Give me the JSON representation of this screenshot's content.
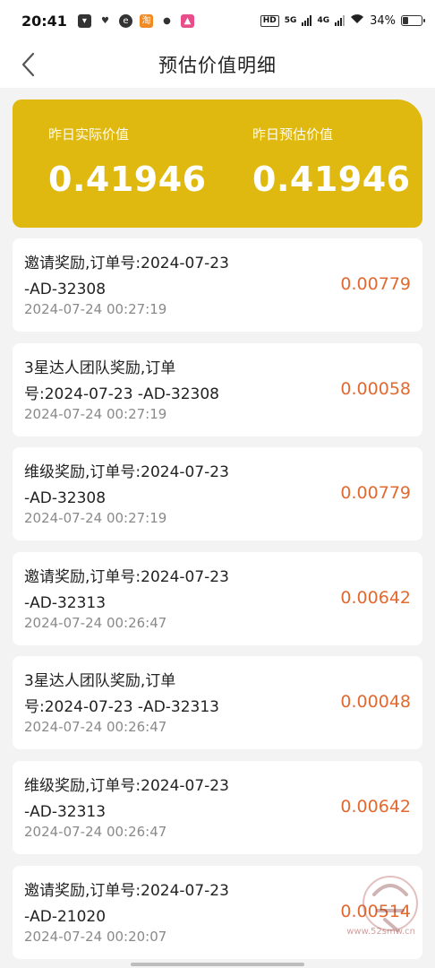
{
  "status_bar": {
    "time": "20:41",
    "network_5g": "5G",
    "network_4g": "4G",
    "hd_label": "HD",
    "battery_text": "34%",
    "battery_level": 0.34
  },
  "header": {
    "title": "预估价值明细"
  },
  "summary": {
    "actual_label": "昨日实际价值",
    "actual_value": "0.41946",
    "estimated_label": "昨日预估价值",
    "estimated_value": "0.41946",
    "accent_color": "#e0b910"
  },
  "records": [
    {
      "desc": "邀请奖励,订单号:2024-07-23 -AD-32308",
      "time": "2024-07-24 00:27:19",
      "amount": "0.00779"
    },
    {
      "desc": "3星达人团队奖励,订单号:2024-07-23 -AD-32308",
      "time": "2024-07-24 00:27:19",
      "amount": "0.00058"
    },
    {
      "desc": "维级奖励,订单号:2024-07-23 -AD-32308",
      "time": "2024-07-24 00:27:19",
      "amount": "0.00779"
    },
    {
      "desc": "邀请奖励,订单号:2024-07-23 -AD-32313",
      "time": "2024-07-24 00:26:47",
      "amount": "0.00642"
    },
    {
      "desc": "3星达人团队奖励,订单号:2024-07-23 -AD-32313",
      "time": "2024-07-24 00:26:47",
      "amount": "0.00048"
    },
    {
      "desc": "维级奖励,订单号:2024-07-23 -AD-32313",
      "time": "2024-07-24 00:26:47",
      "amount": "0.00642"
    },
    {
      "desc": "邀请奖励,订单号:2024-07-23 -AD-21020",
      "time": "2024-07-24 00:20:07",
      "amount": "0.00514"
    }
  ],
  "watermark": {
    "site": "www.52smw.cn"
  },
  "colors": {
    "amount": "#e2692f",
    "background": "#f3f3f3"
  }
}
